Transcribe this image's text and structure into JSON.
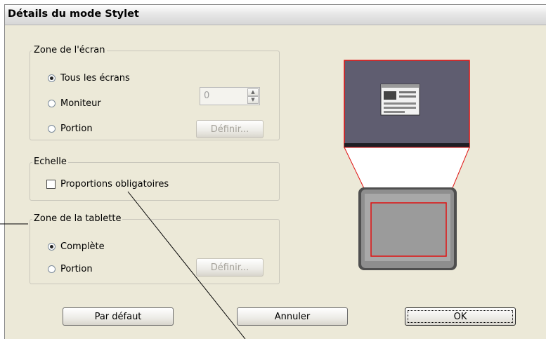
{
  "window": {
    "title": "Détails du mode Stylet"
  },
  "screen_area": {
    "legend": "Zone de l'écran",
    "options": [
      {
        "label": "Tous les écrans",
        "selected": true
      },
      {
        "label": "Moniteur",
        "selected": false
      },
      {
        "label": "Portion",
        "selected": false
      }
    ],
    "monitor_value": "0",
    "define_label": "Définir..."
  },
  "scale": {
    "legend": "Echelle",
    "force_proportions_label": "Proportions obligatoires",
    "force_proportions_checked": false
  },
  "tablet_area": {
    "legend": "Zone de la tablette",
    "options": [
      {
        "label": "Complète",
        "selected": true
      },
      {
        "label": "Portion",
        "selected": false
      }
    ],
    "define_label": "Définir..."
  },
  "buttons": {
    "default_label": "Par défaut",
    "cancel_label": "Annuler",
    "ok_label": "OK"
  },
  "colors": {
    "dialog_bg": "#ece9d8",
    "screen_preview_bg": "#5f5d70",
    "mapping_lines": "#e01010"
  }
}
